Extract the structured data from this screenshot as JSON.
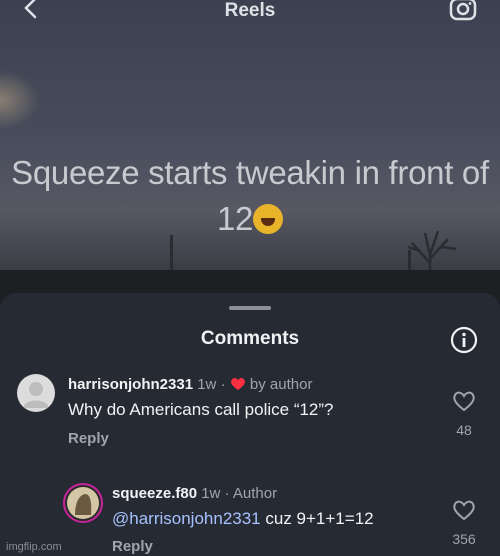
{
  "header": {
    "title": "Reels"
  },
  "video": {
    "caption_line1": "Squeeze starts tweakin in front of",
    "caption_line2": "12"
  },
  "sheet": {
    "title": "Comments"
  },
  "comments": [
    {
      "username": "harrisonjohn2331",
      "age": "1w",
      "badge": "by author",
      "text": "Why do Americans call police “12”?",
      "reply_label": "Reply",
      "likes": "48"
    },
    {
      "username": "squeeze.f80",
      "age": "1w",
      "badge": "Author",
      "mention": "@harrisonjohn2331",
      "text": " cuz 9+1+1=12",
      "reply_label": "Reply",
      "likes": "356"
    }
  ],
  "watermark": "imgflip.com",
  "colors": {
    "accent_heart": "#ff3040",
    "mention": "#a7c1ff",
    "sheet_bg": "#262a33"
  }
}
